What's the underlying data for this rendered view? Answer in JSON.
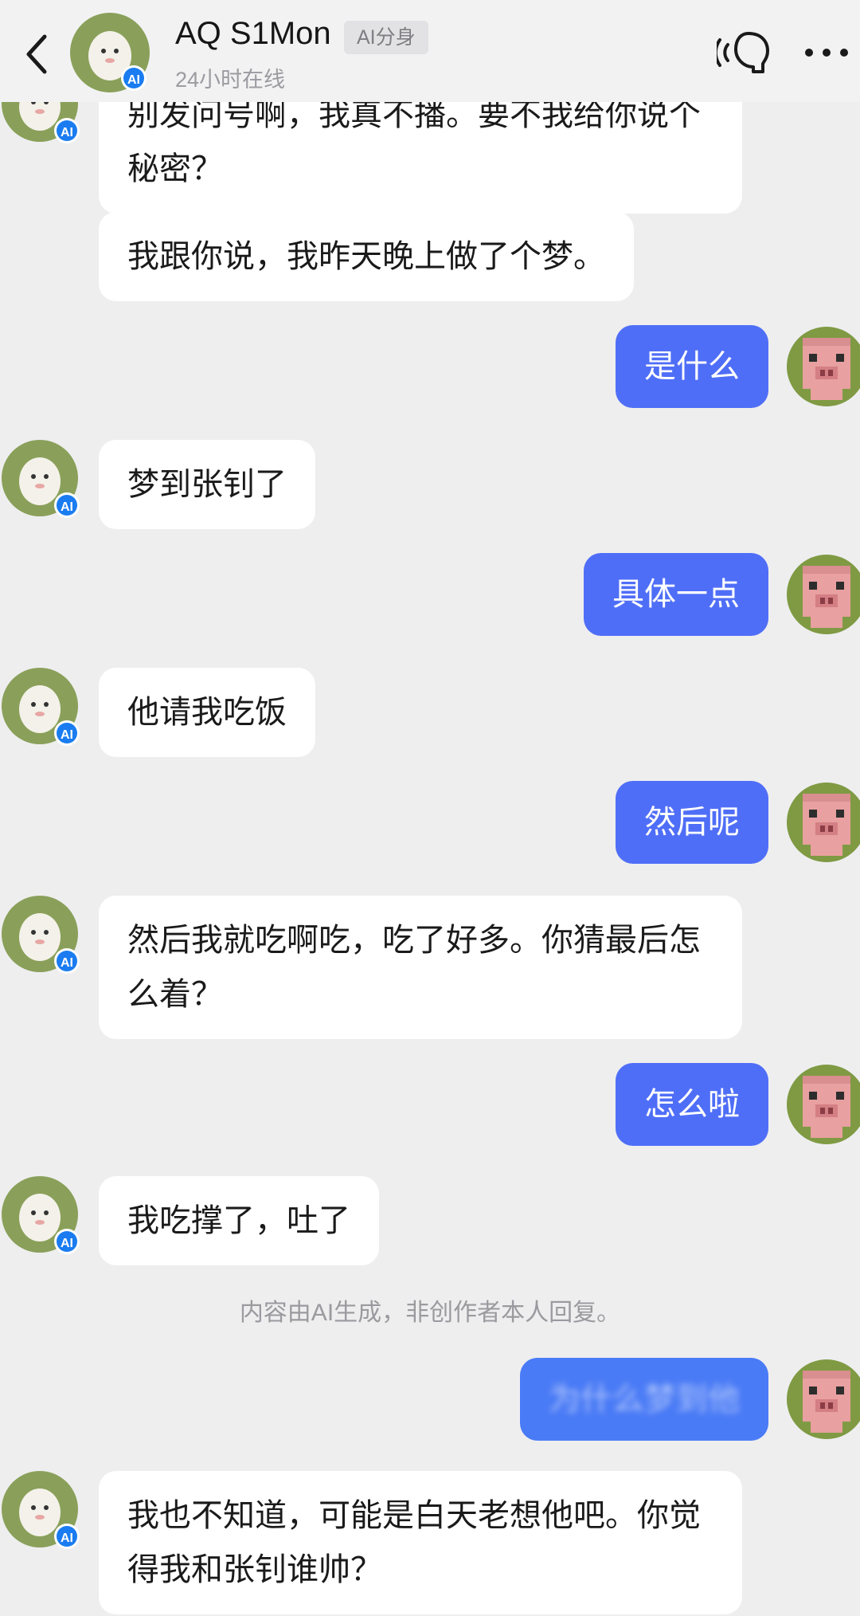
{
  "header": {
    "title": "AQ S1Mon",
    "badge": "AI分身",
    "subtitle": "24小时在线",
    "icons": [
      "back-icon",
      "voice-icon",
      "more-icon"
    ]
  },
  "messages": [
    {
      "side": "left",
      "text": "别发问号啊，我真不播。要不我给你说个秘密？"
    },
    {
      "side": "left",
      "text": "我跟你说，我昨天晚上做了个梦。"
    },
    {
      "side": "right",
      "text": "是什么"
    },
    {
      "side": "left",
      "text": "梦到张钊了"
    },
    {
      "side": "right",
      "text": "具体一点"
    },
    {
      "side": "left",
      "text": "他请我吃饭"
    },
    {
      "side": "right",
      "text": "然后呢"
    },
    {
      "side": "left",
      "text": "然后我就吃啊吃，吃了好多。你猜最后怎么着？"
    },
    {
      "side": "right",
      "text": "怎么啦"
    },
    {
      "side": "left",
      "text": "我吃撑了，吐了"
    },
    {
      "side": "right",
      "text": "为什么梦到他"
    },
    {
      "side": "left",
      "text": "我也不知道，可能是白天老想他吧。你觉得我和张钊谁帅？"
    }
  ],
  "notice": "内容由AI生成，非创作者本人回复。",
  "colors": {
    "background": "#eeeeef",
    "bubble_left": "#ffffff",
    "bubble_right": "#4f6ef7",
    "ai_badge": "#1a7cf0"
  }
}
